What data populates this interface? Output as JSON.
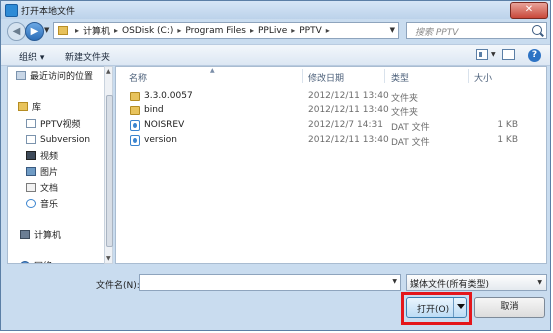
{
  "window": {
    "title": "打开本地文件",
    "close_label": "✕"
  },
  "address": {
    "crumbs": [
      "计算机",
      "OSDisk (C:)",
      "Program Files",
      "PPLive",
      "PPTV"
    ]
  },
  "search": {
    "placeholder": "搜索 PPTV"
  },
  "toolbar": {
    "organize": "组织 ▾",
    "new_folder": "新建文件夹",
    "help": "?"
  },
  "nav": {
    "items": [
      {
        "label": "最近访问的位置",
        "icon": "recent-places-icon"
      },
      {
        "label": "库",
        "icon": "library-icon"
      },
      {
        "label": "PPTV视频",
        "icon": "video-library-icon"
      },
      {
        "label": "Subversion",
        "icon": "subversion-icon"
      },
      {
        "label": "视频",
        "icon": "video-icon"
      },
      {
        "label": "图片",
        "icon": "pictures-icon"
      },
      {
        "label": "文档",
        "icon": "documents-icon"
      },
      {
        "label": "音乐",
        "icon": "music-icon"
      },
      {
        "label": "计算机",
        "icon": "computer-icon"
      },
      {
        "label": "网络",
        "icon": "network-icon"
      }
    ]
  },
  "columns": {
    "name": "名称",
    "modified": "修改日期",
    "type": "类型",
    "size": "大小"
  },
  "files": [
    {
      "name": "3.3.0.0057",
      "modified": "2012/12/11 13:40",
      "type": "文件夹",
      "size": "",
      "icon": "folder-icon"
    },
    {
      "name": "bind",
      "modified": "2012/12/11 13:40",
      "type": "文件夹",
      "size": "",
      "icon": "folder-icon"
    },
    {
      "name": "NOISREV",
      "modified": "2012/12/7 14:31",
      "type": "DAT 文件",
      "size": "1 KB",
      "icon": "dat-file-icon"
    },
    {
      "name": "version",
      "modified": "2012/12/11 13:40",
      "type": "DAT 文件",
      "size": "1 KB",
      "icon": "dat-file-icon"
    }
  ],
  "footer": {
    "filename_label": "文件名(N):",
    "filename_value": "",
    "filetype_value": "媒体文件(所有类型)",
    "open_label": "打开(O)",
    "cancel_label": "取消"
  },
  "colors": {
    "highlight": "#e4161b",
    "window_bg": "#c9dcef",
    "folder": "#e8c35c"
  }
}
